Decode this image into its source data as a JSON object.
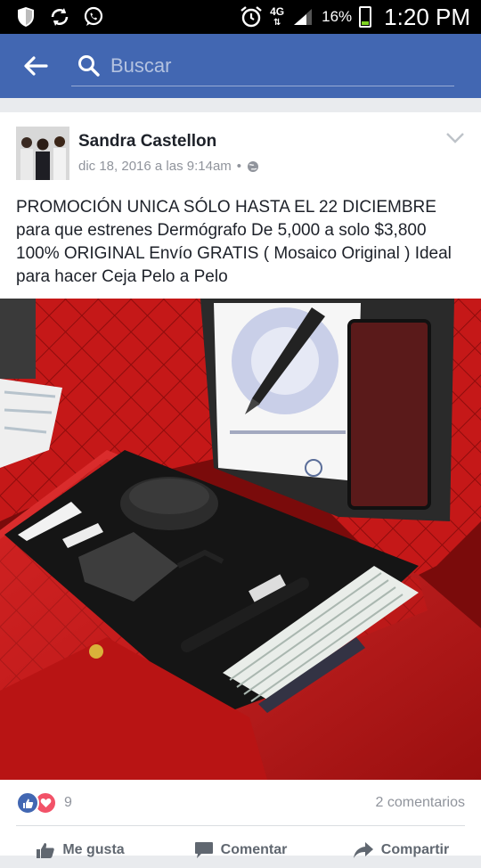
{
  "status_bar": {
    "network": "4G",
    "battery_percent": "16%",
    "time": "1:20 PM",
    "icons": [
      "shield-icon",
      "sync-icon",
      "whatsapp-icon",
      "alarm-icon",
      "signal-icon",
      "battery-icon"
    ]
  },
  "app_bar": {
    "search_placeholder": "Buscar",
    "color": "#4267b2"
  },
  "post": {
    "author": "Sandra Castellon",
    "timestamp": "dic 18, 2016 a las 9:14am",
    "separator": "•",
    "text": "PROMOCIÓN UNICA SÓLO HASTA EL 22 DICIEMBRE para que estrenes Dermógrafo  De 5,000 a solo $3,800 100% ORIGINAL Envío GRATIS ( Mosaico Original ) Ideal para hacer Ceja Pelo a Pelo",
    "reaction_count": "9",
    "comments": "2 comentarios",
    "actions": {
      "like": "Me gusta",
      "comment": "Comentar",
      "share": "Compartir"
    }
  },
  "colors": {
    "like_blue": "#4267b2",
    "love_red": "#f25268",
    "case_red": "#c91a1a"
  }
}
